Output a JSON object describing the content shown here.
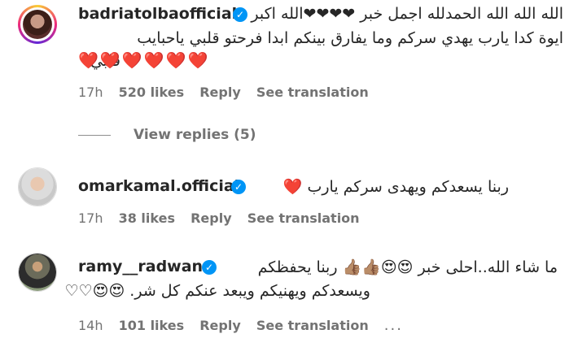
{
  "comments": [
    {
      "username": "badriatolbaofficial",
      "line1": "الله الله الله الحمدلله اجمل خبر ❤❤❤❤الله اكبر",
      "line2": "ايوة كدا يارب يهدي سركم وما يفارق بينكم ابدا فرحتو قلبي ياحبايب",
      "line3": "قلبي",
      "hearts": "❤️❤️❤️❤️❤️❤️",
      "time": "17h",
      "likes": "520 likes",
      "reply": "Reply",
      "translation": "See translation"
    },
    {
      "username": "omarkamal.official",
      "line1": "ربنا يسعدكم ويهدى سركم يارب ❤️",
      "time": "17h",
      "likes": "38 likes",
      "reply": "Reply",
      "translation": "See translation"
    },
    {
      "username": "ramy__radwan",
      "line1": "ما شاء الله..احلى خبر 😍😍👍🏽👍🏽 ربنا يحفظكم",
      "line2": "ويسعدكم ويهنيكم ويبعد عنكم كل شر. 😍😍♡♡",
      "time": "14h",
      "likes": "101 likes",
      "reply": "Reply",
      "translation": "See translation",
      "more": "..."
    }
  ],
  "view_replies": "View replies (5)",
  "colors": {
    "verified": "#0095f6",
    "heart": "#ed4956",
    "meta": "#737373"
  }
}
